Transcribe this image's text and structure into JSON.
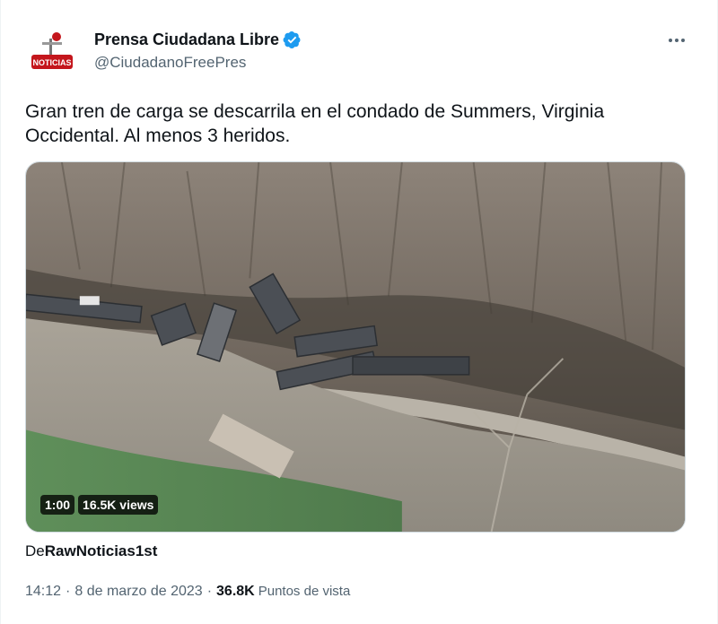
{
  "author": {
    "display_name": "Prensa Ciudadana Libre",
    "handle": "@CiudadanoFreePres",
    "verified": true,
    "avatar_icon": "prensa-logo-icon",
    "avatar_text": "NOTICIAS"
  },
  "tweet": {
    "text_line1": "Gran tren de carga se descarrila en el condado de Summers, Virginia",
    "text_line2": "Occidental. Al menos 3 heridos."
  },
  "video": {
    "duration": "1:00",
    "views": "16.5K views"
  },
  "credit": {
    "prefix": "De",
    "source": "RawNoticias1st"
  },
  "meta": {
    "time": "14:12",
    "separator": "·",
    "date": "8 de marzo de 2023",
    "separator2": "·",
    "views_count": "36.8K",
    "views_label": "Puntos de vista"
  },
  "colors": {
    "verified_blue": "#1d9bf0",
    "secondary_text": "#536471",
    "avatar_red": "#c4161c"
  },
  "icons": {
    "more": "more-dots-icon",
    "verified": "verified-badge-icon"
  }
}
